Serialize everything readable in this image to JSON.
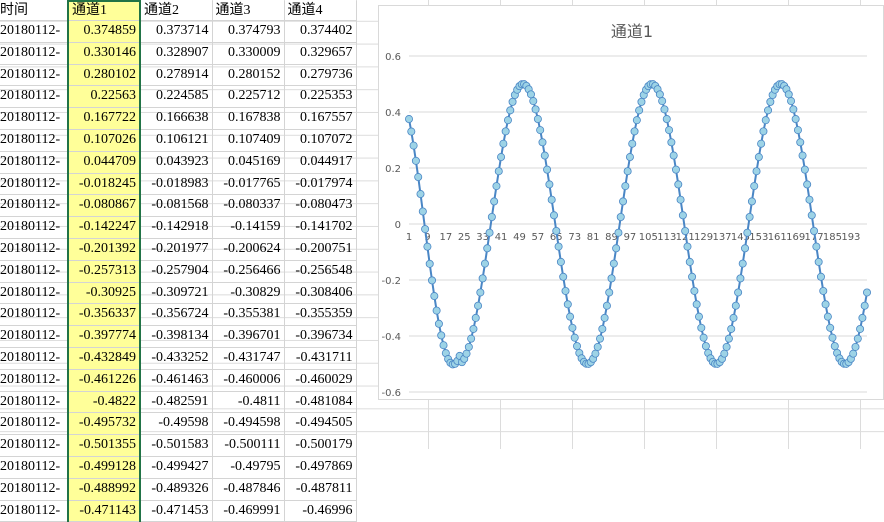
{
  "sheet": {
    "headers": [
      "时间",
      "通道1",
      "通道2",
      "通道3",
      "通道4"
    ],
    "rows": [
      [
        "20180112-",
        "0.374859",
        "0.373714",
        "0.374793",
        "0.374402"
      ],
      [
        "20180112-",
        "0.330146",
        "0.328907",
        "0.330009",
        "0.329657"
      ],
      [
        "20180112-",
        "0.280102",
        "0.278914",
        "0.280152",
        "0.279736"
      ],
      [
        "20180112-",
        "0.22563",
        "0.224585",
        "0.225712",
        "0.225353"
      ],
      [
        "20180112-",
        "0.167722",
        "0.166638",
        "0.167838",
        "0.167557"
      ],
      [
        "20180112-",
        "0.107026",
        "0.106121",
        "0.107409",
        "0.107072"
      ],
      [
        "20180112-",
        "0.044709",
        "0.043923",
        "0.045169",
        "0.044917"
      ],
      [
        "20180112-",
        "-0.018245",
        "-0.018983",
        "-0.017765",
        "-0.017974"
      ],
      [
        "20180112-",
        "-0.080867",
        "-0.081568",
        "-0.080337",
        "-0.080473"
      ],
      [
        "20180112-",
        "-0.142247",
        "-0.142918",
        "-0.14159",
        "-0.141702"
      ],
      [
        "20180112-",
        "-0.201392",
        "-0.201977",
        "-0.200624",
        "-0.200751"
      ],
      [
        "20180112-",
        "-0.257313",
        "-0.257904",
        "-0.256466",
        "-0.256548"
      ],
      [
        "20180112-",
        "-0.30925",
        "-0.309721",
        "-0.30829",
        "-0.308406"
      ],
      [
        "20180112-",
        "-0.356337",
        "-0.356724",
        "-0.355381",
        "-0.355359"
      ],
      [
        "20180112-",
        "-0.397774",
        "-0.398134",
        "-0.396701",
        "-0.396734"
      ],
      [
        "20180112-",
        "-0.432849",
        "-0.433252",
        "-0.431747",
        "-0.431711"
      ],
      [
        "20180112-",
        "-0.461226",
        "-0.461463",
        "-0.460006",
        "-0.460029"
      ],
      [
        "20180112-",
        "-0.4822",
        "-0.482591",
        "-0.4811",
        "-0.481084"
      ],
      [
        "20180112-",
        "-0.495732",
        "-0.49598",
        "-0.494598",
        "-0.494505"
      ],
      [
        "20180112-",
        "-0.501355",
        "-0.501583",
        "-0.500111",
        "-0.500179"
      ],
      [
        "20180112-",
        "-0.499128",
        "-0.499427",
        "-0.49795",
        "-0.497869"
      ],
      [
        "20180112-",
        "-0.488992",
        "-0.489326",
        "-0.487846",
        "-0.487811"
      ],
      [
        "20180112-",
        "-0.471143",
        "-0.471453",
        "-0.469991",
        "-0.46996"
      ]
    ]
  },
  "colors": {
    "highlight": "#ffff99",
    "selection": "#217346",
    "series_line": "#4a86c5",
    "marker_fill": "#9dd3e6",
    "marker_stroke": "#4a86c5"
  },
  "chart_data": {
    "type": "line",
    "title": "通道1",
    "xlabel": "",
    "ylabel": "",
    "ylim": [
      -0.6,
      0.6
    ],
    "yticks": [
      "0.6",
      "0.4",
      "0.2",
      "0",
      "-0.2",
      "-0.4",
      "-0.6"
    ],
    "x_tick_labels": [
      "1",
      "9",
      "17",
      "25",
      "33",
      "41",
      "49",
      "57",
      "65",
      "73",
      "81",
      "89",
      "97",
      "105",
      "113",
      "121",
      "129",
      "137",
      "145",
      "153",
      "161",
      "169",
      "177",
      "185",
      "193"
    ],
    "grid": true,
    "legend": "none",
    "point_count": 200,
    "series": [
      {
        "name": "",
        "amplitude": 0.5,
        "period_points": 56,
        "initial_value": 0.374859,
        "first_values": [
          0.374859,
          0.330146,
          0.280102,
          0.22563,
          0.167722,
          0.107026,
          0.044709,
          -0.018245,
          -0.080867,
          -0.142247,
          -0.201392,
          -0.257313,
          -0.30925,
          -0.356337,
          -0.397774,
          -0.432849,
          -0.461226,
          -0.4822,
          -0.495732,
          -0.501355,
          -0.499128,
          -0.488992,
          -0.471143
        ]
      }
    ]
  }
}
